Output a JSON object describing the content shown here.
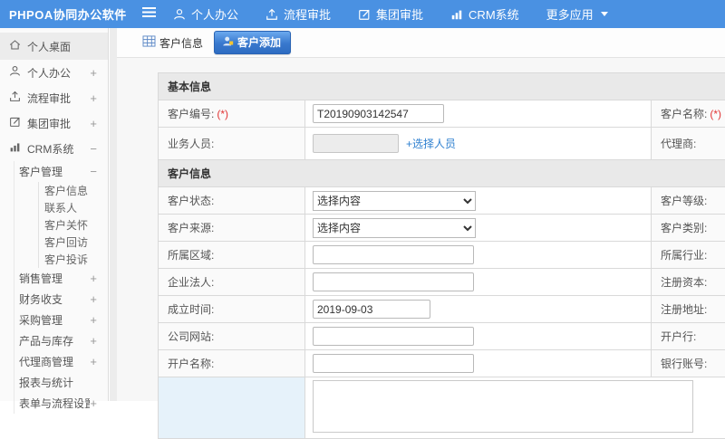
{
  "header": {
    "logo": "PHPOA协同办公软件",
    "menu": [
      {
        "label": "个人办公"
      },
      {
        "label": "流程审批"
      },
      {
        "label": "集团审批"
      },
      {
        "label": "CRM系统"
      },
      {
        "label": "更多应用"
      }
    ]
  },
  "sidebar": {
    "items": [
      {
        "label": "个人桌面",
        "expand": ""
      },
      {
        "label": "个人办公",
        "expand": "+"
      },
      {
        "label": "流程审批",
        "expand": "+"
      },
      {
        "label": "集团审批",
        "expand": "+"
      },
      {
        "label": "CRM系统",
        "expand": "−"
      },
      {
        "label": "客户管理",
        "expand": "−"
      },
      {
        "label": "客户信息",
        "expand": ""
      },
      {
        "label": "联系人",
        "expand": ""
      },
      {
        "label": "客户关怀",
        "expand": ""
      },
      {
        "label": "客户回访",
        "expand": ""
      },
      {
        "label": "客户投诉",
        "expand": ""
      },
      {
        "label": "销售管理",
        "expand": "+"
      },
      {
        "label": "财务收支",
        "expand": "+"
      },
      {
        "label": "采购管理",
        "expand": "+"
      },
      {
        "label": "产品与库存",
        "expand": "+"
      },
      {
        "label": "代理商管理",
        "expand": "+"
      },
      {
        "label": "报表与统计",
        "expand": ""
      },
      {
        "label": "表单与流程设置",
        "expand": "+"
      }
    ]
  },
  "tabs": [
    {
      "label": "客户信息"
    },
    {
      "label": "客户添加"
    }
  ],
  "form": {
    "rows": [
      {
        "title": "基本信息"
      },
      {
        "label": "客户编号:",
        "req": "(*)",
        "input": "T20190903142547",
        "label2": "客户名称:",
        "req2": "(*)"
      },
      {
        "label": "业务人员:",
        "input": "",
        "link": "+选择人员",
        "label2": "代理商:"
      },
      {
        "title": "客户信息"
      },
      {
        "label": "客户状态:",
        "value": "选择内容",
        "label2": "客户等级:"
      },
      {
        "label": "客户来源:",
        "value": "选择内容",
        "label2": "客户类别:"
      },
      {
        "label": "所属区域:",
        "input": "",
        "label2": "所属行业:"
      },
      {
        "label": "企业法人:",
        "input": "",
        "label2": "注册资本:"
      },
      {
        "label": "成立时间:",
        "input": "2019-09-03",
        "label2": "注册地址:"
      },
      {
        "label": "公司网站:",
        "input": "",
        "label2": "开户行:"
      },
      {
        "label": "开户名称:",
        "input": "",
        "label2": "银行账号:"
      },
      {
        "label": ""
      }
    ]
  },
  "colors": {
    "header": "#4a91e2",
    "accent": "#2f80d0",
    "required": "#e13434"
  }
}
